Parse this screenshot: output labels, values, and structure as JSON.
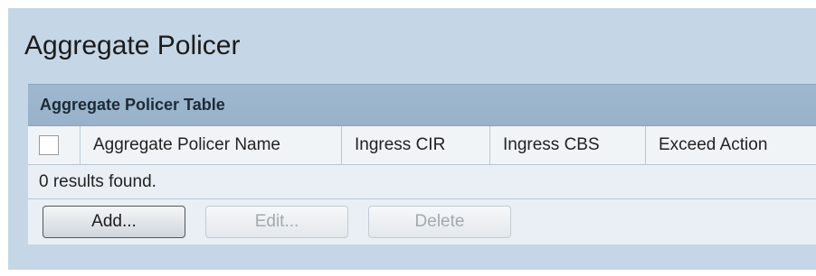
{
  "page": {
    "title": "Aggregate Policer"
  },
  "table": {
    "caption": "Aggregate Policer Table",
    "columns": [
      "Aggregate Policer Name",
      "Ingress CIR",
      "Ingress CBS",
      "Exceed Action"
    ],
    "results_text": "0 results found.",
    "rows": []
  },
  "buttons": {
    "add": "Add...",
    "edit": "Edit...",
    "delete": "Delete"
  },
  "colors": {
    "panel_background": "#c5d6e6",
    "caption_background": "#9fb8cf"
  }
}
